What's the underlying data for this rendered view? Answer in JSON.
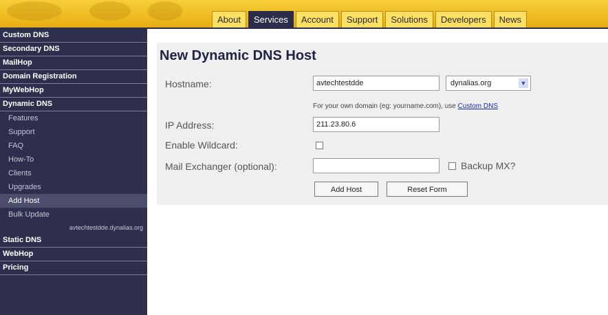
{
  "nav": {
    "tabs": [
      {
        "label": "About",
        "active": false
      },
      {
        "label": "Services",
        "active": true
      },
      {
        "label": "Account",
        "active": false
      },
      {
        "label": "Support",
        "active": false
      },
      {
        "label": "Solutions",
        "active": false
      },
      {
        "label": "Developers",
        "active": false
      },
      {
        "label": "News",
        "active": false
      }
    ]
  },
  "sidebar": {
    "top_sections": [
      "Custom DNS",
      "Secondary DNS",
      "MailHop",
      "Domain Registration",
      "MyWebHop",
      "Dynamic DNS"
    ],
    "dynamic_dns_items": [
      "Features",
      "Support",
      "FAQ",
      "How-To",
      "Clients",
      "Upgrades",
      "Add Host",
      "Bulk Update"
    ],
    "selected_item": "Add Host",
    "existing_host": "avtechtestdde.dynalias.org",
    "bottom_sections": [
      "Static DNS",
      "WebHop",
      "Pricing"
    ]
  },
  "form": {
    "title": "New Dynamic DNS Host",
    "hostname_label": "Hostname:",
    "hostname_value": "avtechtestdde",
    "domain_value": "dynalias.org",
    "hint_text": "For your own domain (eg: yourname.com), use",
    "hint_link": "Custom DNS",
    "ip_label": "IP Address:",
    "ip_value": "211.23.80.6",
    "wildcard_label": "Enable Wildcard:",
    "mx_label": "Mail Exchanger (optional):",
    "mx_value": "",
    "backup_mx_label": "Backup MX?",
    "add_button": "Add Host",
    "reset_button": "Reset Form"
  },
  "colors": {
    "banner": "#f0c030",
    "sidebar": "#2e2f4c",
    "active_tab": "#2c2d4a",
    "link": "#1a2ab0"
  }
}
